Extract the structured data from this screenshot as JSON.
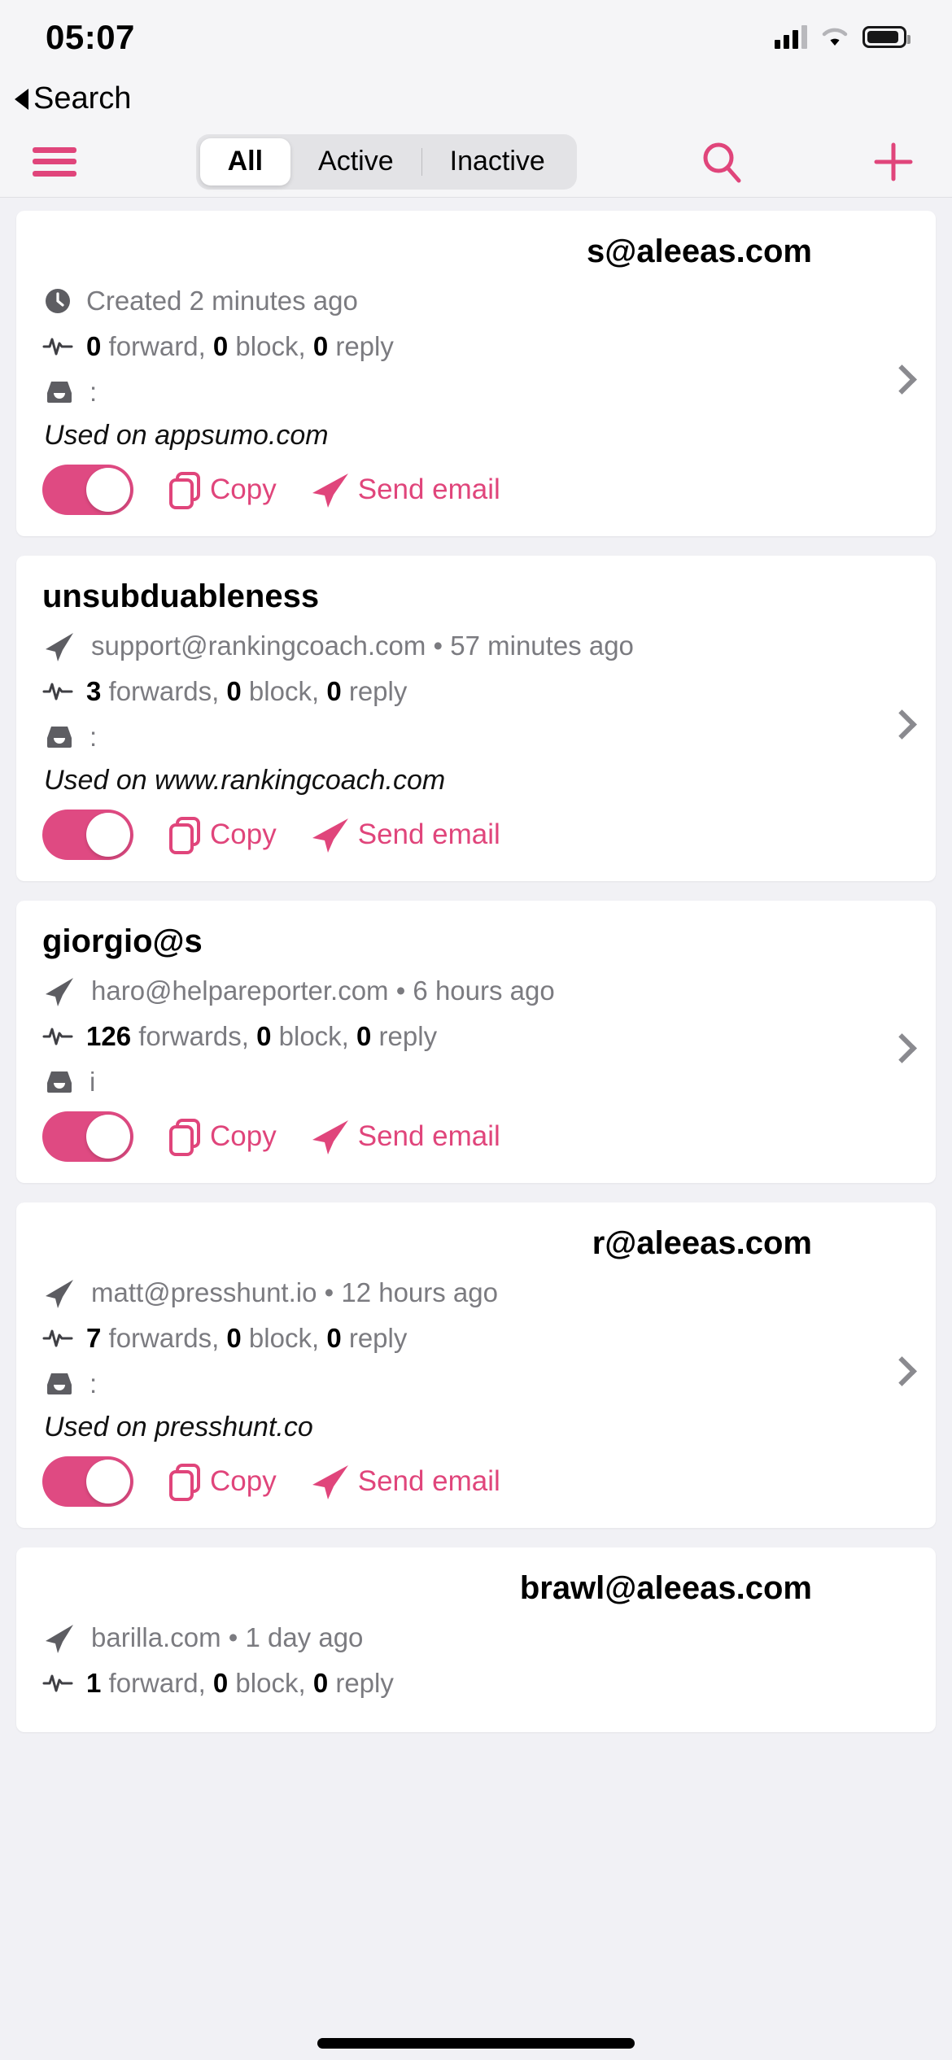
{
  "status_bar": {
    "time": "05:07",
    "signal_icon": "cellular-signal-icon",
    "wifi_icon": "wifi-icon",
    "battery_icon": "battery-icon"
  },
  "back": {
    "label": "Search",
    "icon": "back-caret-icon"
  },
  "toolbar": {
    "menu_icon": "hamburger-menu-icon",
    "search_icon": "search-icon",
    "add_icon": "plus-icon",
    "segments": [
      {
        "label": "All",
        "selected": true
      },
      {
        "label": "Active",
        "selected": false
      },
      {
        "label": "Inactive",
        "selected": false
      }
    ]
  },
  "accent_color": "#e0457b",
  "toggle_color": "#df4a82",
  "card_labels": {
    "copy": "Copy",
    "send_email": "Send email",
    "chevron_icon": "chevron-right-icon",
    "copy_icon": "copy-icon",
    "send_icon": "paper-plane-icon",
    "clock_icon": "clock-icon",
    "pulse_icon": "activity-pulse-icon",
    "inbox_icon": "inbox-icon",
    "toggle_icon": "active-toggle"
  },
  "aliases": [
    {
      "title": "s@aleeas.com",
      "title_align": "right",
      "meta_icon": "clock-icon",
      "meta": "Created 2 minutes ago",
      "stats": [
        {
          "value": "0",
          "label": " forward, "
        },
        {
          "value": "0",
          "label": " block, "
        },
        {
          "value": "0",
          "label": " reply"
        }
      ],
      "inbox": ":",
      "used_on": "Used on appsumo.com",
      "enabled": true
    },
    {
      "title": "unsubduableness",
      "title_align": "left",
      "meta_icon": "paper-plane-icon",
      "meta": "support@rankingcoach.com • 57 minutes ago",
      "stats": [
        {
          "value": "3",
          "label": " forwards, "
        },
        {
          "value": "0",
          "label": " block, "
        },
        {
          "value": "0",
          "label": " reply"
        }
      ],
      "inbox": ":",
      "used_on": "Used on www.rankingcoach.com",
      "enabled": true
    },
    {
      "title": "giorgio@s",
      "title_align": "left",
      "meta_icon": "paper-plane-icon",
      "meta": "haro@helpareporter.com • 6 hours ago",
      "stats": [
        {
          "value": "126",
          "label": " forwards, "
        },
        {
          "value": "0",
          "label": " block, "
        },
        {
          "value": "0",
          "label": " reply"
        }
      ],
      "inbox": "i",
      "used_on": "",
      "enabled": true
    },
    {
      "title": "r@aleeas.com",
      "title_align": "right",
      "meta_icon": "paper-plane-icon",
      "meta": "matt@presshunt.io • 12 hours ago",
      "stats": [
        {
          "value": "7",
          "label": " forwards, "
        },
        {
          "value": "0",
          "label": " block, "
        },
        {
          "value": "0",
          "label": " reply"
        }
      ],
      "inbox": ":",
      "used_on": "Used on presshunt.co",
      "enabled": true
    },
    {
      "title": "brawl@aleeas.com",
      "title_align": "right",
      "meta_icon": "paper-plane-icon",
      "meta": "barilla.com • 1 day ago",
      "stats": [
        {
          "value": "1",
          "label": " forward, "
        },
        {
          "value": "0",
          "label": " block, "
        },
        {
          "value": "0",
          "label": " reply"
        }
      ],
      "inbox": "",
      "used_on": "",
      "enabled": true
    }
  ]
}
